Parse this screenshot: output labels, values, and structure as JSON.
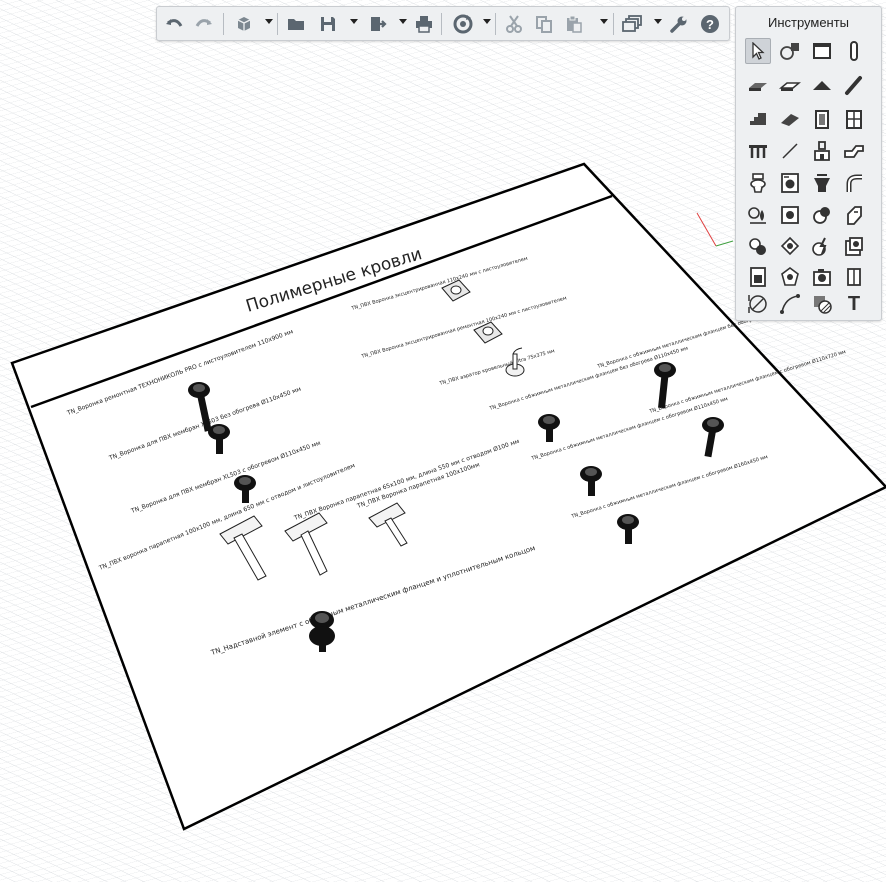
{
  "toolbar": {
    "buttons": [
      {
        "name": "undo-button",
        "icon": "undo-icon"
      },
      {
        "name": "redo-button",
        "icon": "redo-icon"
      },
      {
        "name": "view-3d-button",
        "icon": "cube-icon"
      },
      {
        "name": "open-button",
        "icon": "folder-icon"
      },
      {
        "name": "save-button",
        "icon": "floppy-icon"
      },
      {
        "name": "export-button",
        "icon": "export-icon"
      },
      {
        "name": "print-button",
        "icon": "printer-icon"
      },
      {
        "name": "sync-button",
        "icon": "sync-icon"
      },
      {
        "name": "cut-button",
        "icon": "scissors-icon"
      },
      {
        "name": "copy-button",
        "icon": "copy-icon"
      },
      {
        "name": "paste-button",
        "icon": "paste-icon"
      },
      {
        "name": "layers-button",
        "icon": "layers-icon"
      },
      {
        "name": "settings-button",
        "icon": "wrench-icon"
      },
      {
        "name": "help-button",
        "icon": "help-icon"
      }
    ]
  },
  "tools_panel": {
    "title": "Инструменты",
    "text_tool_label": "T"
  },
  "sheet": {
    "title": "Полимерные кровли",
    "labels": [
      "TN_Воронка ремонтная ТЕХНОНИКОЛЬ PRO с листоуловителем 110х900 мм",
      "TN_Воронка для ПВХ мембран XL503 без обогрева Ø110х450 мм",
      "TN_Воронка для ПВХ мембран XL503 с обогревом Ø110х450 мм",
      "TN_ПВХ Воронка эксцентрированная 110х240 мм с листоуловителем",
      "TN_ПВХ Воронка эксцентрированная ремонтная 100х240 мм с листоуловителем",
      "TN_ПВХ аэратор кровельный Ultra 75х375 мм",
      "TN_Воронка с обжимным металлическим фланцем без обогрева Ø110х450 мм",
      "TN_Воронка с обжимным металлическим фланцем без обогрева Ø110х720 мм",
      "TN_Воронка с обжимным металлическим фланцем с обогревом Ø110х450 мм",
      "TN_Воронка с обжимным металлическим фланцем с обогревом Ø110х720 мм",
      "TN_Воронка с обжимным металлическим фланцем с обогревом Ø160х450 мм",
      "TN_ПВХ воронка парапетная 100х100 мм, длина 650 мм с отводом и листоуловителем",
      "TN_ПВХ Воронка парапетная 65х100 мм, длина 550 мм с отводом Ø100 мм",
      "TN_ПВХ Воронка парапетная 100х100мм",
      "TN_Надставной элемент с обжимным металлическим фланцем и уплотнительным кольцом"
    ]
  }
}
